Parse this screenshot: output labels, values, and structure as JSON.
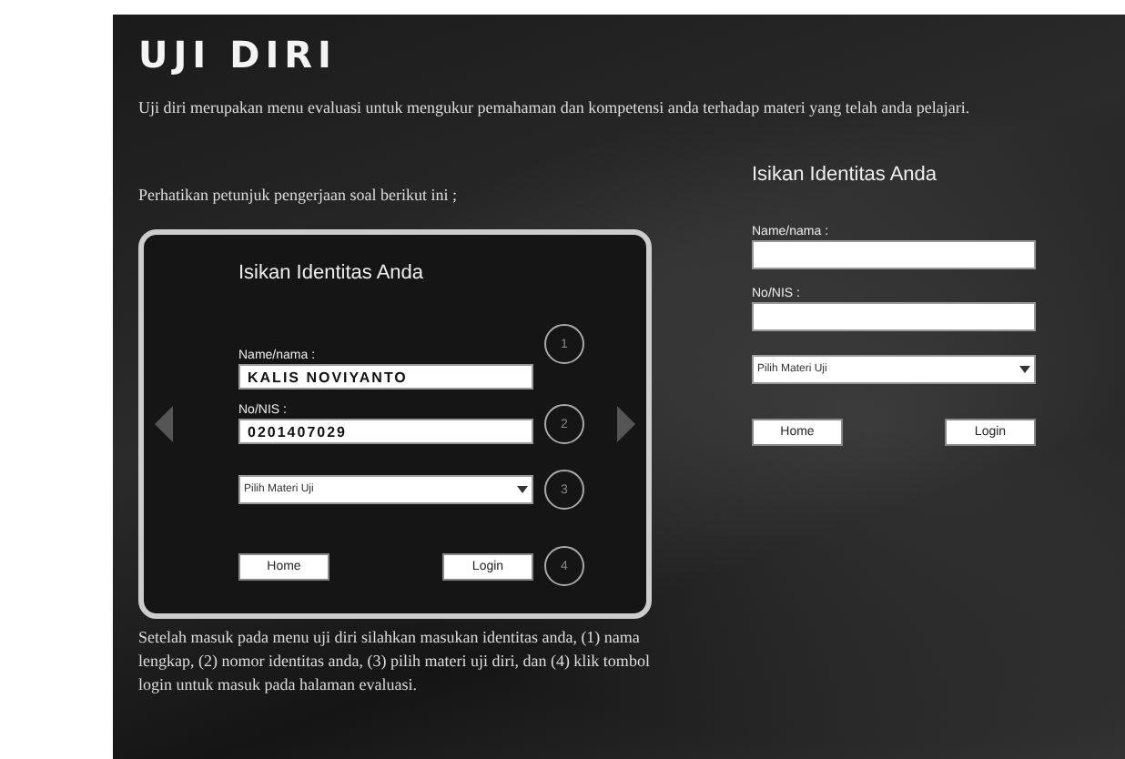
{
  "title": "UJI DIRI",
  "description": "Uji diri merupakan menu evaluasi untuk mengukur pemahaman dan kompetensi anda terhadap materi yang telah anda pelajari.",
  "instruction": "Perhatikan petunjuk pengerjaan soal berikut ini ;",
  "example": {
    "heading": "Isikan Identitas Anda",
    "name_label": "Name/nama :",
    "name_value": "KALIS NOVIYANTO",
    "nis_label": "No/NIS :",
    "nis_value": "0201407029",
    "select_value": "Pilih Materi Uji",
    "buttons": [
      "Home",
      "Login"
    ],
    "callouts": [
      "1",
      "2",
      "3",
      "4"
    ]
  },
  "explanation": "Setelah masuk pada menu uji diri silahkan masukan identitas anda, (1) nama lengkap, (2) nomor identitas anda, (3) pilih materi uji diri, dan (4) klik tombol login untuk masuk pada halaman evaluasi.",
  "form": {
    "heading": "Isikan Identitas Anda",
    "name_label": "Name/nama :",
    "nis_label": "No/NIS :",
    "select_value": "Pilih Materi Uji",
    "buttons": [
      "Home",
      "Login"
    ]
  }
}
